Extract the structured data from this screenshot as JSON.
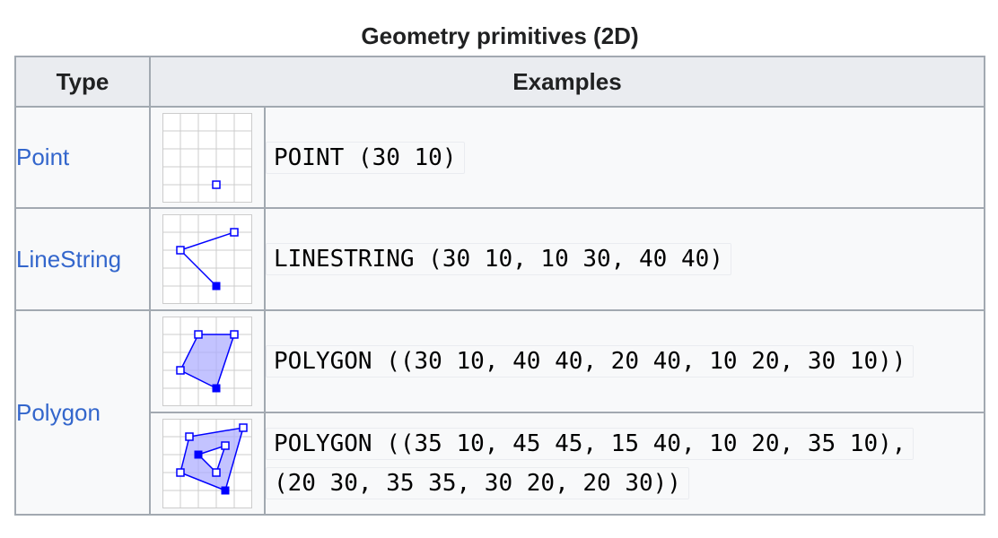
{
  "caption": "Geometry primitives (2D)",
  "headers": {
    "type": "Type",
    "examples": "Examples"
  },
  "rows": [
    {
      "type": "Point",
      "wkt": "POINT (30 10)"
    },
    {
      "type": "LineString",
      "wkt": "LINESTRING (30 10, 10 30, 40 40)"
    },
    {
      "type": "Polygon",
      "wkt": "POLYGON ((30 10, 40 40, 20 40, 10 20, 30 10))"
    },
    {
      "type": "",
      "wkt": "POLYGON ((35 10, 45 45, 15 40, 10 20, 35 10),\n(20 30, 35 35, 30 20, 20 30))"
    }
  ],
  "colors": {
    "link": "#3366cc",
    "geometry": "#0000ff",
    "fill": "#aaaaff",
    "grid": "#cccccc",
    "header_bg": "#eaecf0",
    "border": "#a2a9b1"
  }
}
